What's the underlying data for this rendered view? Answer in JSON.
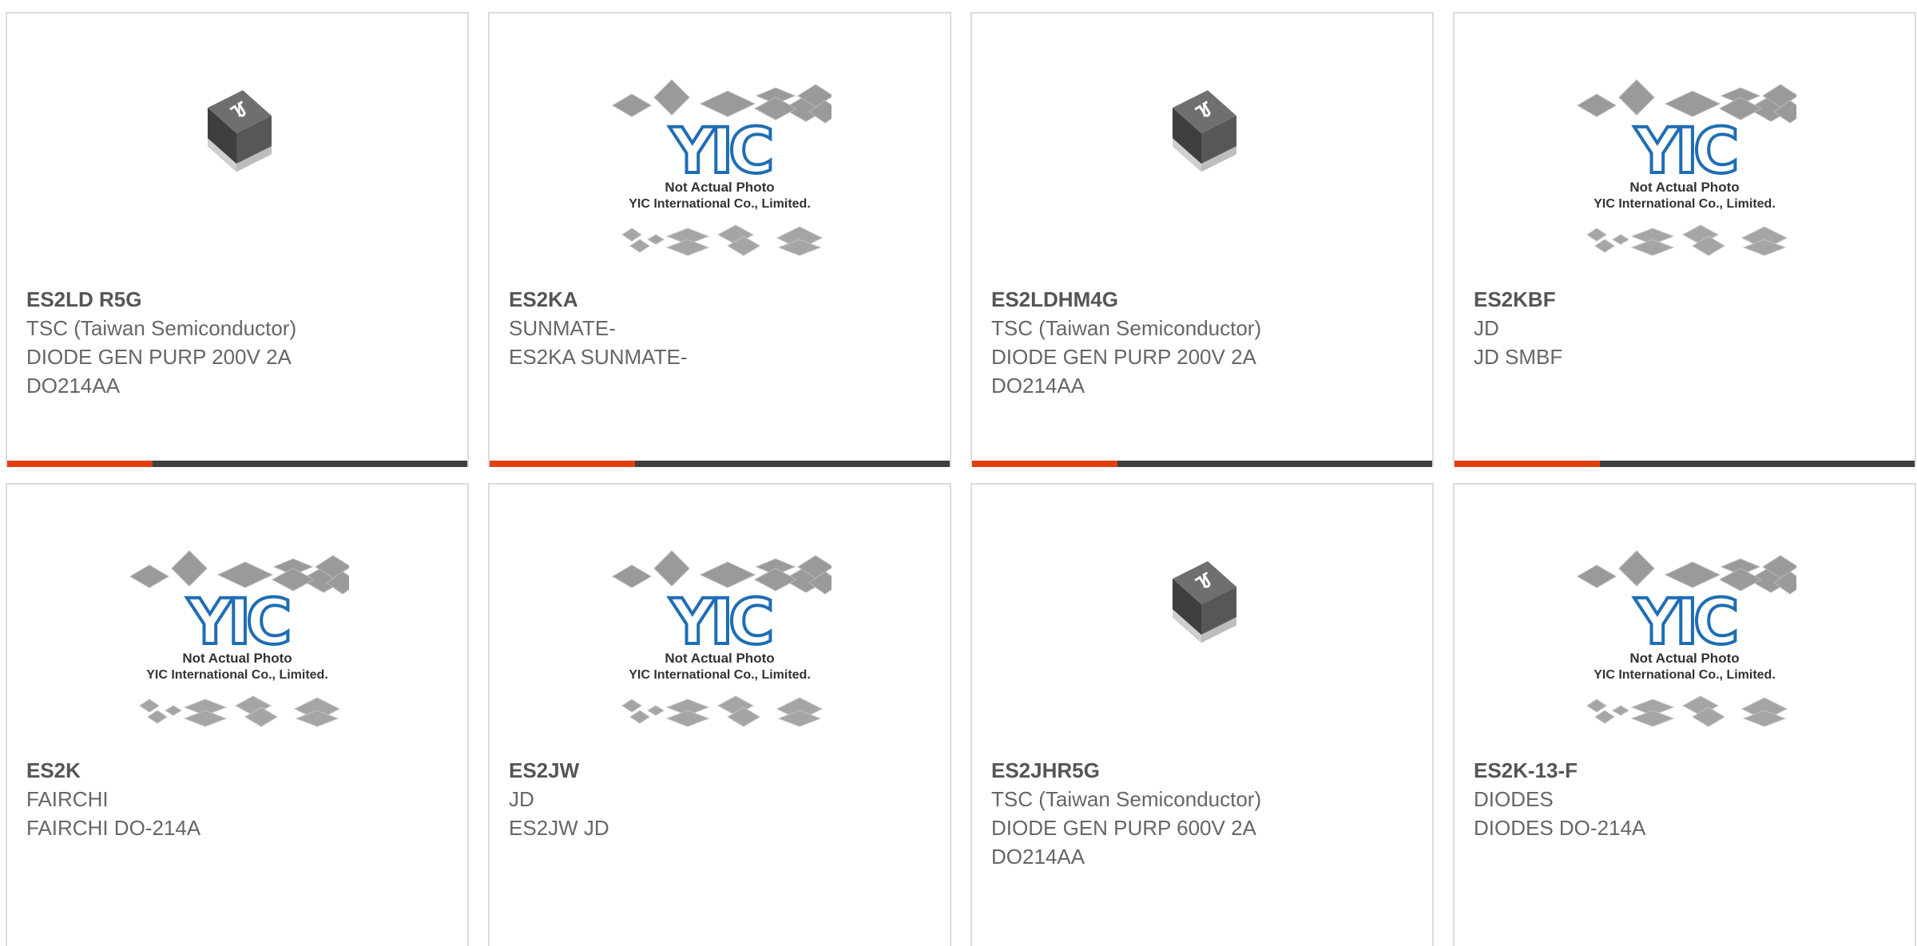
{
  "products": [
    {
      "part": "ES2LD R5G",
      "brand": "TSC (Taiwan Semiconductor)",
      "line1": "DIODE GEN PURP 200V 2A",
      "line2": "DO214AA",
      "image": "chip-package",
      "logo_text": "",
      "note1": "",
      "note2": ""
    },
    {
      "part": "ES2KA",
      "brand": "SUNMATE-",
      "line1": "ES2KA SUNMATE-",
      "line2": "",
      "image": "yic-placeholder",
      "logo_text": "YIC",
      "note1": "Not Actual Photo",
      "note2": "YIC International Co., Limited."
    },
    {
      "part": "ES2LDHM4G",
      "brand": "TSC (Taiwan Semiconductor)",
      "line1": "DIODE GEN PURP 200V 2A",
      "line2": "DO214AA",
      "image": "chip-package",
      "logo_text": "",
      "note1": "",
      "note2": ""
    },
    {
      "part": "ES2KBF",
      "brand": "JD",
      "line1": "JD SMBF",
      "line2": "",
      "image": "yic-placeholder",
      "logo_text": "YIC",
      "note1": "Not Actual Photo",
      "note2": "YIC International Co., Limited."
    },
    {
      "part": "ES2K",
      "brand": "FAIRCHI",
      "line1": "FAIRCHI DO-214A",
      "line2": "",
      "image": "yic-placeholder",
      "logo_text": "YIC",
      "note1": "Not Actual Photo",
      "note2": "YIC International Co., Limited."
    },
    {
      "part": "ES2JW",
      "brand": "JD",
      "line1": "ES2JW JD",
      "line2": "",
      "image": "yic-placeholder",
      "logo_text": "YIC",
      "note1": "Not Actual Photo",
      "note2": "YIC International Co., Limited."
    },
    {
      "part": "ES2JHR5G",
      "brand": "TSC (Taiwan Semiconductor)",
      "line1": "DIODE GEN PURP 600V 2A",
      "line2": "DO214AA",
      "image": "chip-package",
      "logo_text": "",
      "note1": "",
      "note2": ""
    },
    {
      "part": "ES2K-13-F",
      "brand": "DIODES",
      "line1": "DIODES DO-214A",
      "line2": "",
      "image": "yic-placeholder",
      "logo_text": "YIC",
      "note1": "Not Actual Photo",
      "note2": "YIC International Co., Limited."
    }
  ],
  "colors": {
    "accent": "#e23f0f",
    "bar": "#3f3f3f",
    "border": "#dcdcdc",
    "yic_blue": "#1f6db5"
  }
}
